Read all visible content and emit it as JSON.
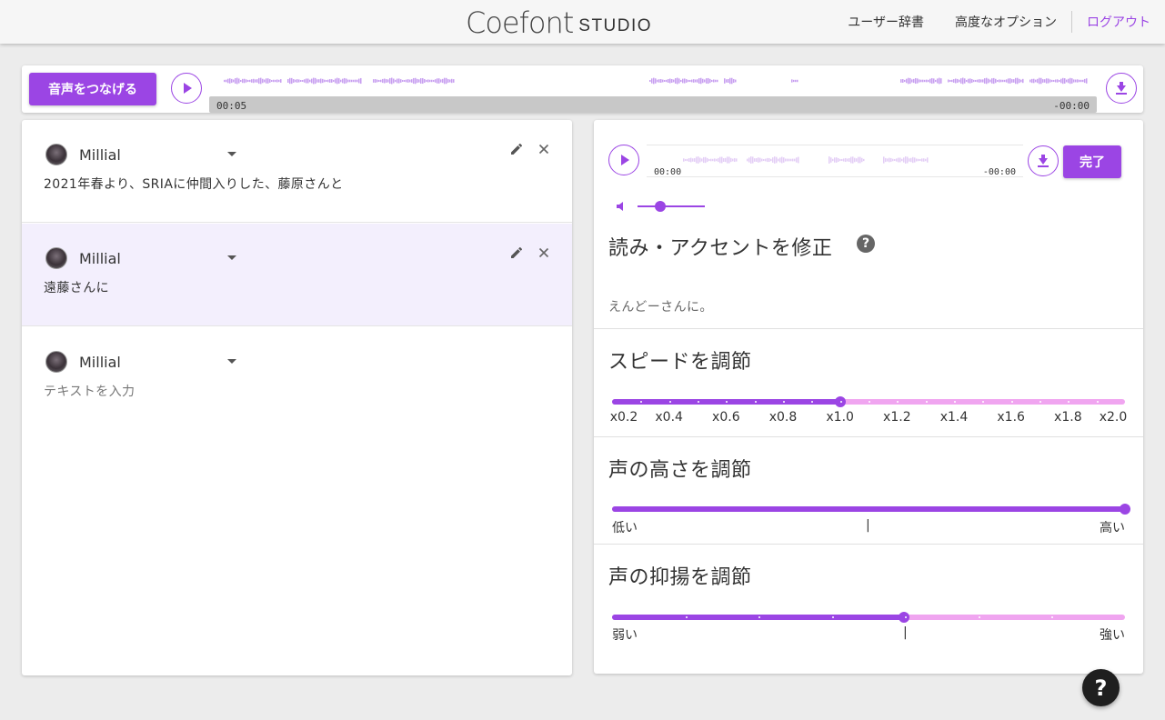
{
  "header": {
    "logo_main": "Coefont",
    "logo_sub": "STUDIO",
    "nav": {
      "user_dictionary": "ユーザー辞書",
      "advanced_options": "高度なオプション",
      "logout": "ログアウト"
    },
    "accent_color": "#9b45e4"
  },
  "topbar": {
    "connect_label": "音声をつなげる",
    "time_start": "00:05",
    "time_end": "-00:00",
    "icons": [
      "play-icon",
      "download-icon"
    ]
  },
  "blocks": [
    {
      "speaker": "Millial",
      "text": "2021年春より、SRIAに仲間入りした、藤原さんと",
      "placeholder": false,
      "active": false,
      "has_actions": true
    },
    {
      "speaker": "Millial",
      "text": "遠藤さんに",
      "placeholder": false,
      "active": true,
      "has_actions": true
    },
    {
      "speaker": "Millial",
      "text": "テキストを入力",
      "placeholder": true,
      "active": false,
      "has_actions": false
    }
  ],
  "editor": {
    "time_start": "00:00",
    "time_end": "-00:00",
    "done_label": "完了",
    "volume_level": 0.35,
    "reading": {
      "title": "読み・アクセントを修正",
      "help": "?",
      "value": "えんどーさんに。"
    },
    "speed": {
      "title": "スピードを調節",
      "ticks": [
        "x0.2",
        "x0.4",
        "x0.6",
        "x0.8",
        "x1.0",
        "x1.2",
        "x1.4",
        "x1.6",
        "x1.8",
        "x2.0"
      ],
      "value": 1.0,
      "min": 0.2,
      "max": 2.0
    },
    "pitch": {
      "title": "声の高さを調節",
      "low_label": "低い",
      "high_label": "高い",
      "center_mark": "|",
      "value": 1.0
    },
    "intonation": {
      "title": "声の抑揚を調節",
      "low_label": "弱い",
      "high_label": "強い",
      "center_mark": "|",
      "value": 0.57
    }
  },
  "help_fab": "?"
}
